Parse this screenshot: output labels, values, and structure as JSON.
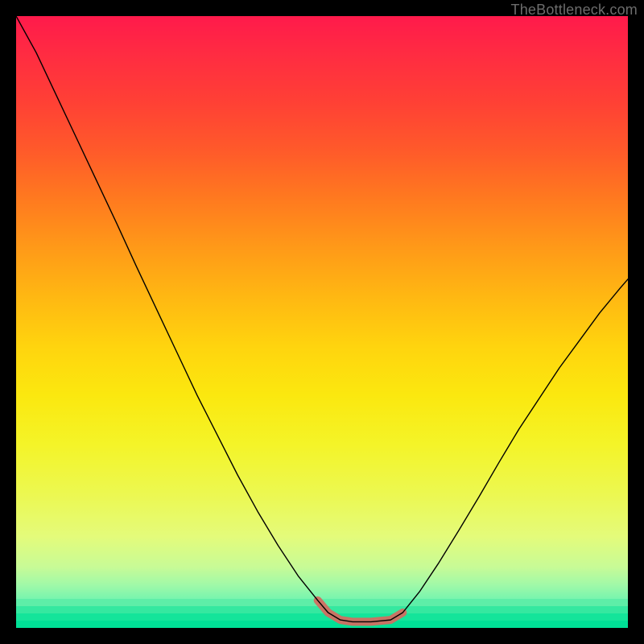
{
  "watermark": "TheBottleneck.com",
  "chart_data": {
    "type": "line",
    "title": "",
    "xlabel": "",
    "ylabel": "",
    "xlim": [
      0,
      100
    ],
    "ylim": [
      0,
      100
    ],
    "grid": false,
    "legend": false,
    "annotations": [],
    "background_gradient": {
      "orientation": "vertical",
      "stops": [
        {
          "pos": 0.0,
          "color": "#ff1a4b"
        },
        {
          "pos": 0.3,
          "color": "#ff7a1f"
        },
        {
          "pos": 0.55,
          "color": "#ffd40e"
        },
        {
          "pos": 0.78,
          "color": "#ecf850"
        },
        {
          "pos": 0.93,
          "color": "#a0f9a8"
        },
        {
          "pos": 1.0,
          "color": "#00e4a0"
        }
      ]
    },
    "series": [
      {
        "name": "bottleneck-curve",
        "color": "#000000",
        "x": [
          0.0,
          3.3,
          6.6,
          9.9,
          13.2,
          16.5,
          19.7,
          23.0,
          26.3,
          29.6,
          32.9,
          36.2,
          39.5,
          42.8,
          46.1,
          49.3,
          51.0,
          53.0,
          55.0,
          58.0,
          61.2,
          63.2,
          66.0,
          69.0,
          72.4,
          75.7,
          78.9,
          82.2,
          85.5,
          88.8,
          92.1,
          95.4,
          98.7,
          100.0
        ],
        "y": [
          100.0,
          94.0,
          87.0,
          80.0,
          73.0,
          66.0,
          59.0,
          52.0,
          45.0,
          38.0,
          31.5,
          25.0,
          19.0,
          13.5,
          8.5,
          4.5,
          2.5,
          1.3,
          1.0,
          1.0,
          1.3,
          2.5,
          6.0,
          10.5,
          16.0,
          21.5,
          27.0,
          32.5,
          37.5,
          42.5,
          47.0,
          51.5,
          55.5,
          57.0
        ]
      },
      {
        "name": "bottleneck-highlight",
        "color": "#d66a5f",
        "x": [
          49.3,
          51.0,
          53.0,
          55.0,
          58.0,
          61.2,
          63.2
        ],
        "y": [
          4.5,
          2.5,
          1.3,
          1.0,
          1.0,
          1.3,
          2.5
        ]
      }
    ]
  }
}
